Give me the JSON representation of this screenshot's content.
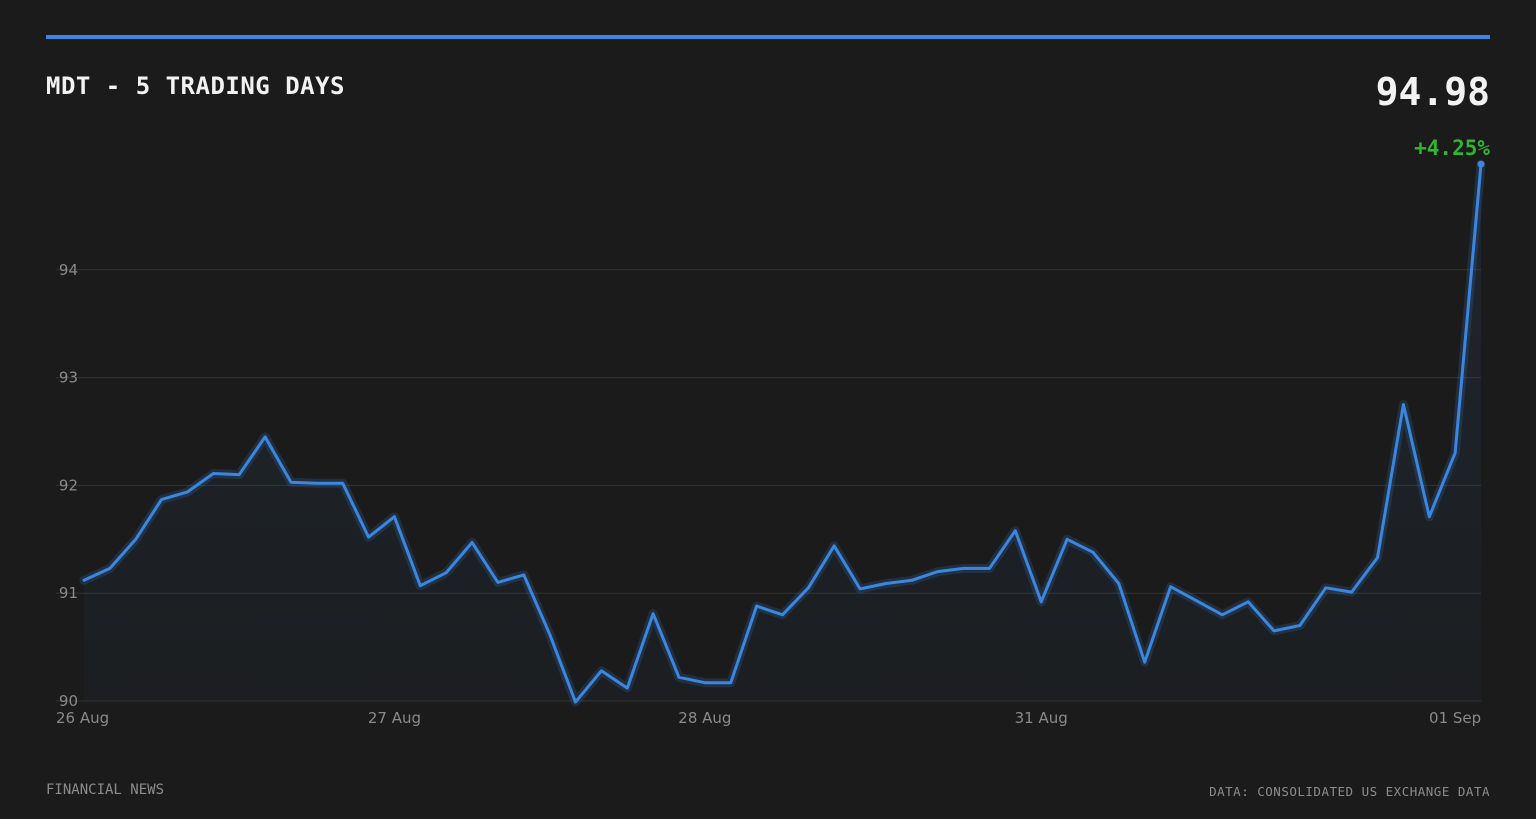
{
  "header": {
    "title": "MDT - 5 TRADING DAYS",
    "price": "94.98",
    "change": "+4.25%"
  },
  "footer": {
    "left": "FINANCIAL NEWS",
    "right": "DATA: CONSOLIDATED US EXCHANGE DATA"
  },
  "colors": {
    "background": "#1b1b1b",
    "accent": "#3b87e0",
    "positive": "#2fb52f",
    "grid": "#333333"
  },
  "chart_data": {
    "type": "area",
    "ylim": [
      90,
      95
    ],
    "yticks": [
      90,
      91,
      92,
      93,
      94
    ],
    "xticks": [
      {
        "label": "26 Aug",
        "index": 0
      },
      {
        "label": "27 Aug",
        "index": 12
      },
      {
        "label": "28 Aug",
        "index": 24
      },
      {
        "label": "31 Aug",
        "index": 37
      },
      {
        "label": "01 Sep",
        "index": 53
      }
    ],
    "values": [
      91.12,
      91.23,
      91.5,
      91.87,
      91.94,
      92.11,
      92.1,
      92.45,
      92.03,
      92.02,
      92.02,
      91.52,
      91.71,
      91.07,
      91.19,
      91.47,
      91.1,
      91.17,
      90.62,
      89.99,
      90.28,
      90.12,
      90.81,
      90.22,
      90.17,
      90.17,
      90.88,
      90.8,
      91.05,
      91.44,
      91.04,
      91.09,
      91.12,
      91.2,
      91.23,
      91.23,
      91.58,
      90.92,
      91.5,
      91.38,
      91.09,
      90.36,
      91.06,
      90.93,
      90.8,
      90.92,
      90.65,
      90.7,
      91.05,
      91.01,
      91.33,
      92.75,
      91.71,
      92.3,
      94.98
    ]
  }
}
